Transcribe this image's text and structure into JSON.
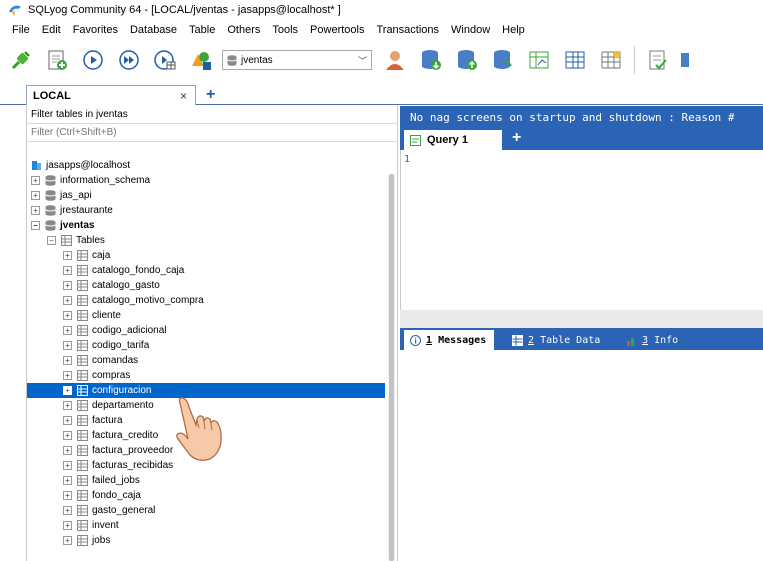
{
  "window": {
    "title": "SQLyog Community 64 - [LOCAL/jventas - jasapps@localhost* ]"
  },
  "menu": [
    "File",
    "Edit",
    "Favorites",
    "Database",
    "Table",
    "Others",
    "Tools",
    "Powertools",
    "Transactions",
    "Window",
    "Help"
  ],
  "toolbar": {
    "database_selector_value": "jventas"
  },
  "connection_tab": {
    "label": "LOCAL",
    "close": "×",
    "add": "+"
  },
  "object_browser": {
    "filter_label": "Filter tables in jventas",
    "filter_placeholder": "Filter (Ctrl+Shift+B)",
    "root": "jasapps@localhost",
    "databases": [
      "information_schema",
      "jas_api",
      "jrestaurante"
    ],
    "active_database": "jventas",
    "tables_folder": "Tables",
    "tables": [
      "caja",
      "catalogo_fondo_caja",
      "catalogo_gasto",
      "catalogo_motivo_compra",
      "cliente",
      "codigo_adicional",
      "codigo_tarifa",
      "comandas",
      "compras",
      "configuracion",
      "departamento",
      "factura",
      "factura_credito",
      "factura_proveedor",
      "facturas_recibidas",
      "failed_jobs",
      "fondo_caja",
      "gasto_general",
      "invent",
      "jobs"
    ],
    "selected_table": "configuracion"
  },
  "right_panel": {
    "nag_text": "No nag screens on startup and shutdown : Reason #",
    "query_tab": "Query 1",
    "query_add": "+",
    "line_number": "1",
    "results_tabs": {
      "messages_num": "1",
      "messages_label": "Messages",
      "table_data_num": "2",
      "table_data_label": "Table Data",
      "info_num": "3",
      "info_label": "Info"
    }
  },
  "colors": {
    "accent_blue": "#2b63b5",
    "selection_blue": "#0066cc"
  }
}
